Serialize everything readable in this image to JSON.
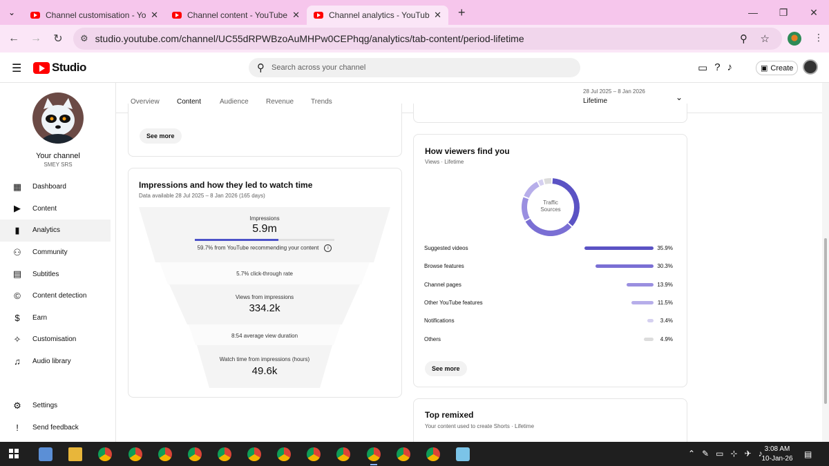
{
  "browser": {
    "tabs": [
      {
        "title": "Channel customisation - YouTube Studio",
        "active": false
      },
      {
        "title": "Channel content - YouTube Studio",
        "active": false
      },
      {
        "title": "Channel analytics - YouTube Studio",
        "active": true
      }
    ],
    "url": "studio.youtube.com/channel/UC55dRPWBzoAuMHPw0CEPhqg/analytics/tab-content/period-lifetime"
  },
  "header": {
    "logo_text": "Studio",
    "search_placeholder": "Search across your channel",
    "create_label": "Create"
  },
  "sidebar": {
    "channel_label": "Your channel",
    "channel_handle": "SMEY SRS",
    "items": [
      {
        "label": "Dashboard",
        "icon": "dashboard-icon",
        "glyph": "▦"
      },
      {
        "label": "Content",
        "icon": "content-icon",
        "glyph": "▶"
      },
      {
        "label": "Analytics",
        "icon": "analytics-icon",
        "glyph": "▮"
      },
      {
        "label": "Community",
        "icon": "community-icon",
        "glyph": "⚇"
      },
      {
        "label": "Subtitles",
        "icon": "subtitles-icon",
        "glyph": "▤"
      },
      {
        "label": "Content detection",
        "icon": "content-detection-icon",
        "glyph": "©"
      },
      {
        "label": "Earn",
        "icon": "earn-icon",
        "glyph": "$"
      },
      {
        "label": "Customisation",
        "icon": "customisation-icon",
        "glyph": "✧"
      },
      {
        "label": "Audio library",
        "icon": "audio-library-icon",
        "glyph": "♫"
      }
    ],
    "bottom_items": [
      {
        "label": "Settings",
        "icon": "settings-icon",
        "glyph": "⚙"
      },
      {
        "label": "Send feedback",
        "icon": "feedback-icon",
        "glyph": "!"
      }
    ],
    "active_index": 2
  },
  "tabs": {
    "items": [
      "Overview",
      "Content",
      "Audience",
      "Revenue",
      "Trends"
    ],
    "active": "Content",
    "period_range": "28 Jul 2025 – 8 Jan 2026",
    "period_label": "Lifetime"
  },
  "top_card": {
    "see_more": "See more"
  },
  "impressions_card": {
    "title": "Impressions and how they led to watch time",
    "subtitle": "Data available 28 Jul 2025 – 8 Jan 2026 (165 days)",
    "impressions_label": "Impressions",
    "impressions_value": "5.9m",
    "recommend_fraction": 0.597,
    "recommend_text": "59.7% from YouTube recommending your content",
    "ctr_text": "5.7% click-through rate",
    "views_label": "Views from impressions",
    "views_value": "334.2k",
    "avd_text": "8:54 average view duration",
    "watch_label": "Watch time from impressions (hours)",
    "watch_value": "49.6k"
  },
  "traffic_card": {
    "title": "How viewers find you",
    "subtitle": "Views · Lifetime",
    "donut_label_1": "Traffic",
    "donut_label_2": "Sources",
    "see_more": "See more",
    "rows": [
      {
        "name": "Suggested videos",
        "pct": "35.9%",
        "value": 35.9,
        "color": "#5b53c4"
      },
      {
        "name": "Browse features",
        "pct": "30.3%",
        "value": 30.3,
        "color": "#7a6fd4"
      },
      {
        "name": "Channel pages",
        "pct": "13.9%",
        "value": 13.9,
        "color": "#9a8fe0"
      },
      {
        "name": "Other YouTube features",
        "pct": "11.5%",
        "value": 11.5,
        "color": "#b7aeea"
      },
      {
        "name": "Notifications",
        "pct": "3.4%",
        "value": 3.4,
        "color": "#d5d0f0"
      },
      {
        "name": "Others",
        "pct": "4.9%",
        "value": 4.9,
        "color": "#dcdcdc"
      }
    ]
  },
  "remixed_card": {
    "title": "Top remixed",
    "subtitle": "Your content used to create Shorts · Lifetime"
  },
  "taskbar": {
    "time": "3:08 AM",
    "date": "10-Jan-26"
  }
}
